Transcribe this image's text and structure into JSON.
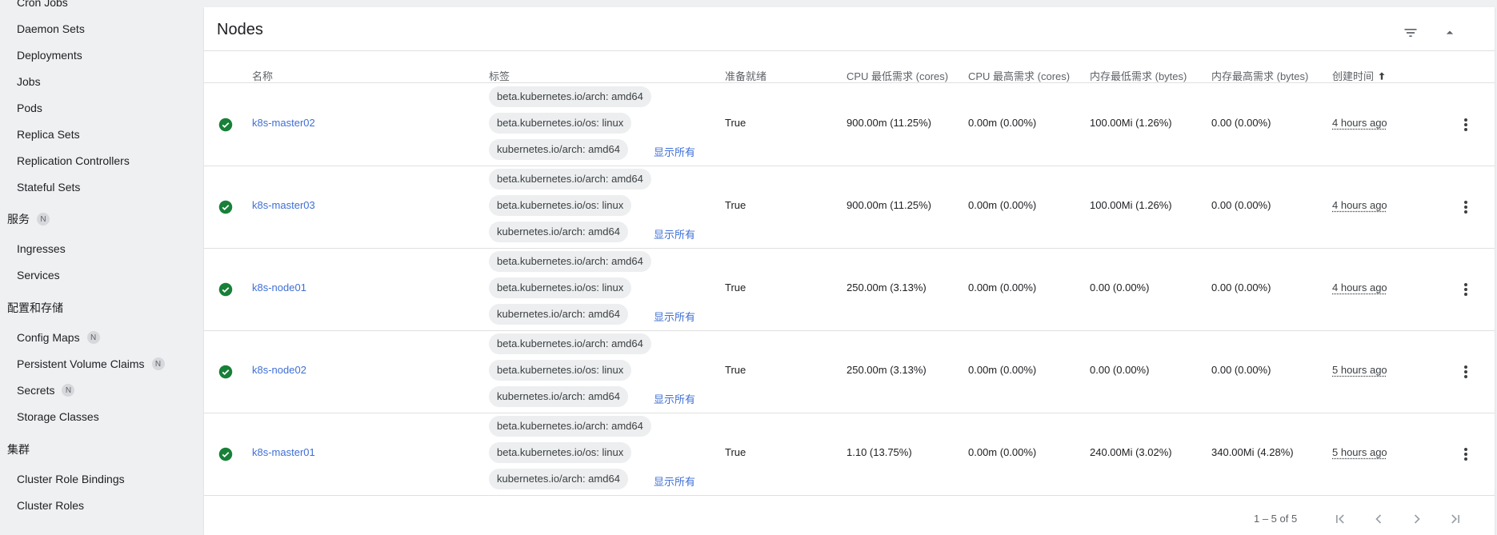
{
  "sidebar": {
    "items": [
      {
        "label": "Cron Jobs"
      },
      {
        "label": "Daemon Sets"
      },
      {
        "label": "Deployments"
      },
      {
        "label": "Jobs"
      },
      {
        "label": "Pods"
      },
      {
        "label": "Replica Sets"
      },
      {
        "label": "Replication Controllers"
      },
      {
        "label": "Stateful Sets"
      }
    ],
    "services_header": "服务",
    "services_badge": "N",
    "services_items": [
      {
        "label": "Ingresses"
      },
      {
        "label": "Services"
      }
    ],
    "config_header": "配置和存储",
    "config_items": [
      {
        "label": "Config Maps",
        "badge": "N"
      },
      {
        "label": "Persistent Volume Claims",
        "badge": "N"
      },
      {
        "label": "Secrets",
        "badge": "N"
      },
      {
        "label": "Storage Classes"
      }
    ],
    "cluster_header": "集群",
    "cluster_items": [
      {
        "label": "Cluster Role Bindings"
      },
      {
        "label": "Cluster Roles"
      }
    ]
  },
  "card": {
    "title": "Nodes",
    "icons": {
      "filter": "filter-icon",
      "collapse": "chevron-up-icon"
    }
  },
  "table": {
    "headers": {
      "name": "名称",
      "labels": "标签",
      "ready": "准备就绪",
      "cpu_req": "CPU 最低需求 (cores)",
      "cpu_lim": "CPU 最高需求 (cores)",
      "mem_req": "内存最低需求 (bytes)",
      "mem_lim": "内存最高需求 (bytes)",
      "created": "创建时间"
    },
    "show_all": "显示所有",
    "rows": [
      {
        "name": "k8s-master02",
        "labels": [
          "beta.kubernetes.io/arch: amd64",
          "beta.kubernetes.io/os: linux",
          "kubernetes.io/arch: amd64"
        ],
        "ready": "True",
        "cpu_req": "900.00m (11.25%)",
        "cpu_lim": "0.00m (0.00%)",
        "mem_req": "100.00Mi (1.26%)",
        "mem_lim": "0.00 (0.00%)",
        "age": "4 hours ago"
      },
      {
        "name": "k8s-master03",
        "labels": [
          "beta.kubernetes.io/arch: amd64",
          "beta.kubernetes.io/os: linux",
          "kubernetes.io/arch: amd64"
        ],
        "ready": "True",
        "cpu_req": "900.00m (11.25%)",
        "cpu_lim": "0.00m (0.00%)",
        "mem_req": "100.00Mi (1.26%)",
        "mem_lim": "0.00 (0.00%)",
        "age": "4 hours ago"
      },
      {
        "name": "k8s-node01",
        "labels": [
          "beta.kubernetes.io/arch: amd64",
          "beta.kubernetes.io/os: linux",
          "kubernetes.io/arch: amd64"
        ],
        "ready": "True",
        "cpu_req": "250.00m (3.13%)",
        "cpu_lim": "0.00m (0.00%)",
        "mem_req": "0.00 (0.00%)",
        "mem_lim": "0.00 (0.00%)",
        "age": "4 hours ago"
      },
      {
        "name": "k8s-node02",
        "labels": [
          "beta.kubernetes.io/arch: amd64",
          "beta.kubernetes.io/os: linux",
          "kubernetes.io/arch: amd64"
        ],
        "ready": "True",
        "cpu_req": "250.00m (3.13%)",
        "cpu_lim": "0.00m (0.00%)",
        "mem_req": "0.00 (0.00%)",
        "mem_lim": "0.00 (0.00%)",
        "age": "5 hours ago"
      },
      {
        "name": "k8s-master01",
        "labels": [
          "beta.kubernetes.io/arch: amd64",
          "beta.kubernetes.io/os: linux",
          "kubernetes.io/arch: amd64"
        ],
        "ready": "True",
        "cpu_req": "1.10 (13.75%)",
        "cpu_lim": "0.00m (0.00%)",
        "mem_req": "240.00Mi (3.02%)",
        "mem_lim": "340.00Mi (4.28%)",
        "age": "5 hours ago"
      }
    ]
  },
  "pagination": {
    "range": "1 – 5 of 5"
  },
  "colors": {
    "accent": "#3f6fd6",
    "ok": "#188038"
  }
}
